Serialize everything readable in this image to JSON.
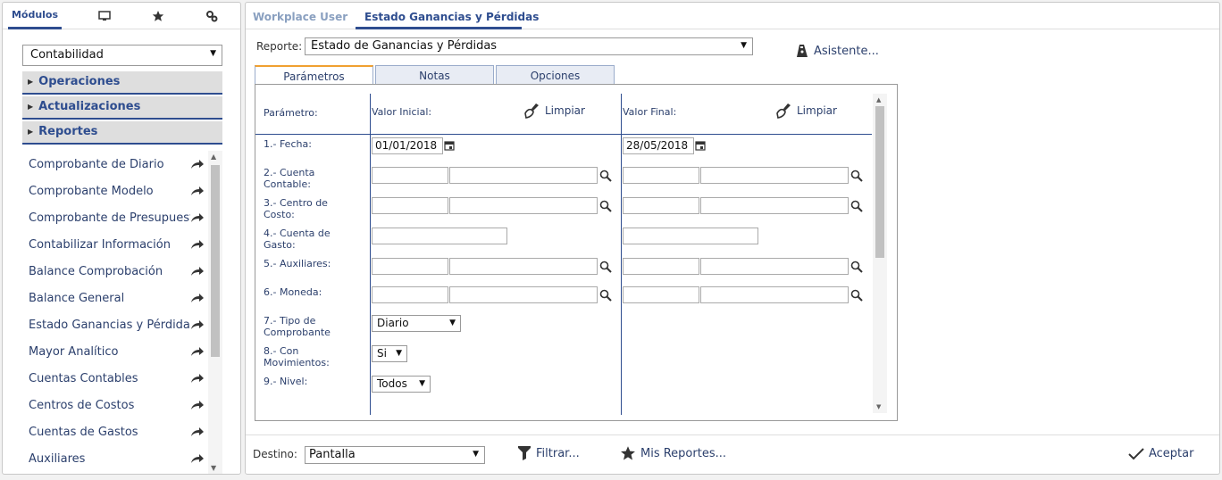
{
  "left_panel": {
    "tabs": [
      {
        "label": "Módulos",
        "icon": "modules-tab"
      },
      {
        "label": "",
        "icon": "monitor-icon"
      },
      {
        "label": "",
        "icon": "star-icon"
      },
      {
        "label": "",
        "icon": "gears-icon"
      }
    ],
    "module_select": {
      "value": "Contabilidad"
    },
    "sections": [
      "Operaciones",
      "Actualizaciones",
      "Reportes"
    ],
    "menu_items": [
      "Comprobante de Diario",
      "Comprobante Modelo",
      "Comprobante de Presupuestos",
      "Contabilizar Información",
      "Balance Comprobación",
      "Balance General",
      "Estado Ganancias y Pérdidas",
      "Mayor Analítico",
      "Cuentas Contables",
      "Centros de Costos",
      "Cuentas de Gastos",
      "Auxiliares"
    ]
  },
  "right_panel": {
    "tabs": [
      {
        "label": "Workplace User",
        "active": false
      },
      {
        "label": "Estado Ganancias y Pérdidas",
        "active": true
      }
    ],
    "report": {
      "label": "Reporte:",
      "value": "Estado de Ganancias y Pérdidas"
    },
    "wizard_label": "Asistente...",
    "param_tabs": [
      "Parámetros",
      "Notas",
      "Opciones"
    ],
    "columns": {
      "param": "Parámetro:",
      "initial": "Valor Inicial:",
      "final": "Valor Final:",
      "clear_label": "Limpiar"
    },
    "params": [
      {
        "label_1": "1.- Fecha:",
        "label_2": ""
      },
      {
        "label_1": "2.- Cuenta",
        "label_2": "Contable:"
      },
      {
        "label_1": "3.- Centro de",
        "label_2": "Costo:"
      },
      {
        "label_1": "4.- Cuenta de",
        "label_2": "Gasto:"
      },
      {
        "label_1": "5.- Auxiliares:",
        "label_2": ""
      },
      {
        "label_1": "6.- Moneda:",
        "label_2": ""
      },
      {
        "label_1": "7.- Tipo de",
        "label_2": "Comprobante"
      },
      {
        "label_1": "8.- Con",
        "label_2": "Movimientos:"
      },
      {
        "label_1": "9.- Nivel:",
        "label_2": ""
      }
    ],
    "fecha_inicial": "01/01/2018",
    "fecha_final": "28/05/2018",
    "tipo_comprobante": "Diario",
    "con_movimientos": "Si",
    "nivel": "Todos",
    "footer": {
      "destino_label": "Destino:",
      "destino_value": "Pantalla",
      "filtrar": "Filtrar...",
      "mis_reportes": "Mis Reportes...",
      "aceptar": "Aceptar"
    }
  },
  "colors": {
    "primary": "#2e4d8f",
    "tab_accent": "#f0a030",
    "section_bg": "#dedede"
  }
}
